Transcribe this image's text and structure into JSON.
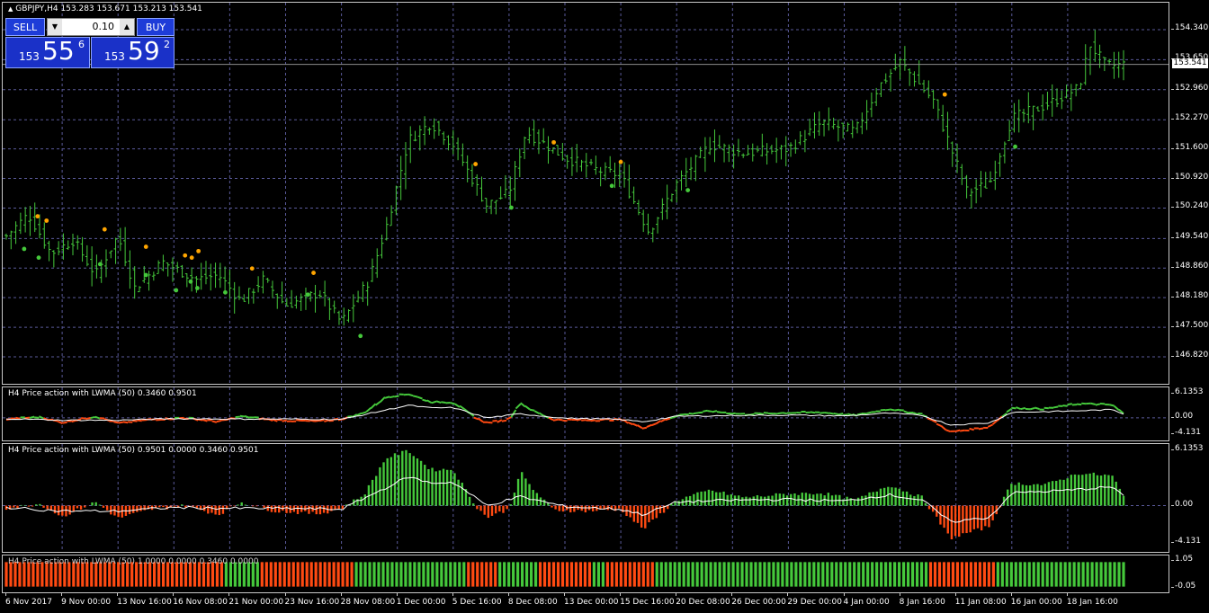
{
  "window_title": "GBPJPY,H4  153.283 153.671 153.213 153.541",
  "colors": {
    "up": "#45c83b",
    "down": "#ff4a12",
    "grid": "#5a5a9a",
    "dot_orange": "#ffa500",
    "dot_green": "#45c83b"
  },
  "trade_panel": {
    "sell_label": "SELL",
    "buy_label": "BUY",
    "lot_value": "0.10",
    "lot_down_icon": "triangle-down",
    "lot_up_icon": "triangle-up",
    "sell_quote": {
      "prefix": "153",
      "big": "55",
      "sup": "6"
    },
    "buy_quote": {
      "prefix": "153",
      "big": "59",
      "sup": "2"
    }
  },
  "main_chart": {
    "price_axis": [
      "154.340",
      "153.650",
      "152.960",
      "152.270",
      "151.600",
      "150.920",
      "150.240",
      "149.540",
      "148.860",
      "148.180",
      "147.500",
      "146.820"
    ],
    "current_price": "153.541"
  },
  "indicator1": {
    "title": "H4 Price action with LWMA (50) 0.3460 0.9501",
    "axis": [
      "6.1353",
      "0.00",
      "-4.131"
    ]
  },
  "indicator2": {
    "title": "H4 Price action with LWMA (50) 0.9501 0.0000 0.3460 0.9501",
    "axis": [
      "6.1353",
      "0.00",
      "-4.131"
    ]
  },
  "indicator3": {
    "title": "H4 Price action with LWMA (50) 1.0000 0.0000 0.3460 0.0000",
    "axis": [
      "1.05",
      "-0.05"
    ]
  },
  "time_axis": [
    "6 Nov 2017",
    "9 Nov 00:00",
    "13 Nov 16:00",
    "16 Nov 08:00",
    "21 Nov 00:00",
    "23 Nov 16:00",
    "28 Nov 08:00",
    "1 Dec 00:00",
    "5 Dec 16:00",
    "8 Dec 08:00",
    "13 Dec 00:00",
    "15 Dec 16:00",
    "20 Dec 08:00",
    "26 Dec 00:00",
    "29 Dec 00:00",
    "4 Jan 00:00",
    "8 Jan 16:00",
    "11 Jan 08:00",
    "16 Jan 00:00",
    "18 Jan 16:00"
  ],
  "chart_data": [
    {
      "type": "ohlc-bars",
      "title": "GBPJPY,H4",
      "ylim": [
        146.82,
        154.34
      ],
      "close_path": [
        [
          0,
          149.6
        ],
        [
          0.02,
          150.1
        ],
        [
          0.04,
          149.2
        ],
        [
          0.06,
          149.5
        ],
        [
          0.08,
          148.7
        ],
        [
          0.1,
          149.6
        ],
        [
          0.115,
          148.4
        ],
        [
          0.14,
          149.0
        ],
        [
          0.17,
          148.6
        ],
        [
          0.19,
          148.7
        ],
        [
          0.21,
          148.1
        ],
        [
          0.23,
          148.6
        ],
        [
          0.25,
          148.0
        ],
        [
          0.28,
          148.3
        ],
        [
          0.3,
          147.6
        ],
        [
          0.325,
          148.6
        ],
        [
          0.34,
          149.8
        ],
        [
          0.36,
          151.8
        ],
        [
          0.38,
          152.2
        ],
        [
          0.4,
          151.7
        ],
        [
          0.43,
          150.3
        ],
        [
          0.45,
          150.6
        ],
        [
          0.465,
          152.0
        ],
        [
          0.5,
          151.4
        ],
        [
          0.53,
          151.1
        ],
        [
          0.55,
          151.0
        ],
        [
          0.575,
          149.7
        ],
        [
          0.6,
          150.8
        ],
        [
          0.63,
          151.7
        ],
        [
          0.66,
          151.5
        ],
        [
          0.7,
          151.6
        ],
        [
          0.73,
          152.2
        ],
        [
          0.76,
          152.0
        ],
        [
          0.78,
          153.0
        ],
        [
          0.8,
          153.6
        ],
        [
          0.83,
          152.7
        ],
        [
          0.86,
          150.6
        ],
        [
          0.88,
          150.8
        ],
        [
          0.9,
          152.3
        ],
        [
          0.93,
          152.6
        ],
        [
          0.96,
          153.0
        ],
        [
          0.97,
          154.0
        ],
        [
          0.985,
          153.5
        ],
        [
          1.0,
          153.54
        ]
      ],
      "orange_dots": [
        [
          0.028,
          150.05
        ],
        [
          0.036,
          149.95
        ],
        [
          0.088,
          149.75
        ],
        [
          0.125,
          149.35
        ],
        [
          0.16,
          149.15
        ],
        [
          0.166,
          149.1
        ],
        [
          0.172,
          149.25
        ],
        [
          0.22,
          148.85
        ],
        [
          0.275,
          148.75
        ],
        [
          0.42,
          151.25
        ],
        [
          0.49,
          151.75
        ],
        [
          0.55,
          151.3
        ],
        [
          0.84,
          152.85
        ]
      ],
      "green_dots": [
        [
          0.016,
          149.3
        ],
        [
          0.029,
          149.1
        ],
        [
          0.084,
          148.95
        ],
        [
          0.125,
          148.7
        ],
        [
          0.152,
          148.35
        ],
        [
          0.165,
          148.55
        ],
        [
          0.171,
          148.4
        ],
        [
          0.196,
          148.3
        ],
        [
          0.27,
          148.25
        ],
        [
          0.317,
          147.3
        ],
        [
          0.452,
          150.25
        ],
        [
          0.542,
          150.75
        ],
        [
          0.61,
          150.65
        ],
        [
          0.903,
          151.65
        ]
      ]
    },
    {
      "type": "line",
      "title": "H4 Price action with LWMA (50)",
      "ylim": [
        -4.131,
        6.1353
      ],
      "series": [
        {
          "name": "",
          "color_up": "#45c83b",
          "color_down": "#ff4a12",
          "points": [
            [
              0,
              -0.3
            ],
            [
              0.03,
              0.2
            ],
            [
              0.05,
              -1.2
            ],
            [
              0.08,
              0.4
            ],
            [
              0.1,
              -1.4
            ],
            [
              0.13,
              -0.4
            ],
            [
              0.16,
              0.0
            ],
            [
              0.19,
              -1.0
            ],
            [
              0.21,
              0.4
            ],
            [
              0.24,
              -0.6
            ],
            [
              0.28,
              -0.9
            ],
            [
              0.3,
              -0.3
            ],
            [
              0.32,
              1.2
            ],
            [
              0.34,
              5.3
            ],
            [
              0.36,
              6.1
            ],
            [
              0.38,
              4.0
            ],
            [
              0.4,
              4.0
            ],
            [
              0.42,
              0.0
            ],
            [
              0.43,
              -1.3
            ],
            [
              0.45,
              -0.4
            ],
            [
              0.46,
              3.8
            ],
            [
              0.47,
              2.0
            ],
            [
              0.49,
              -0.5
            ],
            [
              0.52,
              -0.6
            ],
            [
              0.55,
              -0.4
            ],
            [
              0.57,
              -2.6
            ],
            [
              0.6,
              0.6
            ],
            [
              0.63,
              1.7
            ],
            [
              0.66,
              0.9
            ],
            [
              0.7,
              1.3
            ],
            [
              0.73,
              1.4
            ],
            [
              0.76,
              0.6
            ],
            [
              0.79,
              2.3
            ],
            [
              0.82,
              0.9
            ],
            [
              0.845,
              -3.6
            ],
            [
              0.88,
              -2.3
            ],
            [
              0.9,
              2.5
            ],
            [
              0.93,
              2.3
            ],
            [
              0.96,
              3.6
            ],
            [
              0.99,
              3.3
            ],
            [
              1.0,
              1.0
            ]
          ]
        },
        {
          "name": "",
          "color": "#ffffff",
          "points": [
            [
              0,
              -0.2
            ],
            [
              0.05,
              -0.6
            ],
            [
              0.1,
              -0.6
            ],
            [
              0.15,
              -0.2
            ],
            [
              0.2,
              -0.3
            ],
            [
              0.25,
              -0.3
            ],
            [
              0.3,
              -0.4
            ],
            [
              0.33,
              1.4
            ],
            [
              0.36,
              3.2
            ],
            [
              0.38,
              2.5
            ],
            [
              0.4,
              2.6
            ],
            [
              0.43,
              0.0
            ],
            [
              0.46,
              1.0
            ],
            [
              0.5,
              -0.1
            ],
            [
              0.55,
              -0.4
            ],
            [
              0.57,
              -1.0
            ],
            [
              0.6,
              0.4
            ],
            [
              0.65,
              0.6
            ],
            [
              0.7,
              0.7
            ],
            [
              0.75,
              0.5
            ],
            [
              0.79,
              1.2
            ],
            [
              0.82,
              0.6
            ],
            [
              0.845,
              -1.8
            ],
            [
              0.88,
              -1.3
            ],
            [
              0.9,
              1.4
            ],
            [
              0.95,
              1.7
            ],
            [
              0.99,
              2.1
            ],
            [
              1.0,
              1.0
            ]
          ]
        }
      ]
    },
    {
      "type": "histogram",
      "title": "H4 Price action with LWMA (50)",
      "ylim": [
        -4.131,
        6.1353
      ],
      "note_source": "same envelope as indicator line"
    },
    {
      "type": "histogram",
      "title": "H4 Price action with LWMA (50)",
      "ylim": [
        -0.05,
        1.05
      ],
      "segments": [
        [
          0,
          0.195,
          "down"
        ],
        [
          0.195,
          0.225,
          "up"
        ],
        [
          0.225,
          0.31,
          "down"
        ],
        [
          0.31,
          0.41,
          "up"
        ],
        [
          0.41,
          0.44,
          "down"
        ],
        [
          0.44,
          0.475,
          "up"
        ],
        [
          0.475,
          0.525,
          "down"
        ],
        [
          0.525,
          0.535,
          "up"
        ],
        [
          0.535,
          0.58,
          "down"
        ],
        [
          0.58,
          0.825,
          "up"
        ],
        [
          0.825,
          0.885,
          "down"
        ],
        [
          0.885,
          1.0,
          "up"
        ]
      ]
    }
  ]
}
